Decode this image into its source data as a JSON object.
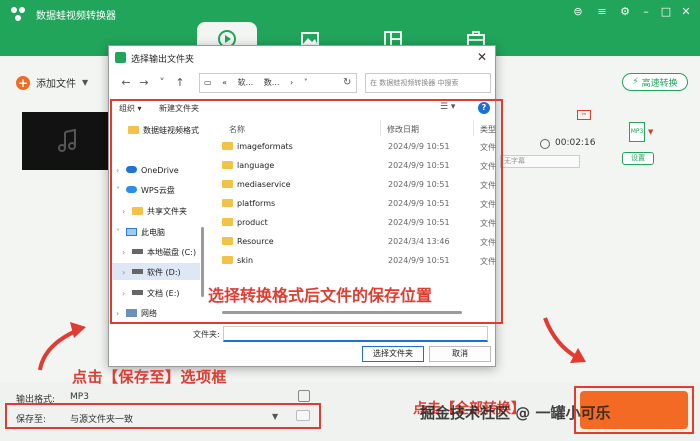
{
  "app": {
    "title": "数据蛙视频转换器",
    "nav_tabs": [
      "convert",
      "edit",
      "collage",
      "toolbox"
    ],
    "add_file_label": "添加文件",
    "high_speed_label": "高速转换",
    "duration": "00:02:16",
    "subtitle_placeholder": "无字幕",
    "format_badge": "MP3",
    "settings_label": "设置"
  },
  "bottom": {
    "output_format_label": "输出格式:",
    "output_format_value": "MP3",
    "save_to_label": "保存至:",
    "save_to_value": "与源文件夹一致"
  },
  "dialog": {
    "title": "选择输出文件夹",
    "breadcrumb": [
      "«",
      "软...",
      "数...",
      "›"
    ],
    "search_placeholder": "在 数据蛙视频转换器 中搜索",
    "organize_label": "组织 ▾",
    "new_folder_label": "新建文件夹",
    "tree": [
      {
        "label": "数据蛙视频格式",
        "icon": "folder"
      },
      {
        "label": "OneDrive",
        "icon": "cloud"
      },
      {
        "label": "WPS云盘",
        "icon": "wps-cloud"
      },
      {
        "label": "共享文件夹",
        "icon": "folder"
      },
      {
        "label": "此电脑",
        "icon": "pc"
      },
      {
        "label": "本地磁盘 (C:)",
        "icon": "drive"
      },
      {
        "label": "软件 (D:)",
        "icon": "drive"
      },
      {
        "label": "文档 (E:)",
        "icon": "drive"
      },
      {
        "label": "网络",
        "icon": "network"
      }
    ],
    "columns": {
      "name": "名称",
      "modified": "修改日期",
      "type": "类型"
    },
    "files": [
      {
        "name": "imageformats",
        "date": "2024/9/9 10:51",
        "type": "文件"
      },
      {
        "name": "language",
        "date": "2024/9/9 10:51",
        "type": "文件"
      },
      {
        "name": "mediaservice",
        "date": "2024/9/9 10:51",
        "type": "文件"
      },
      {
        "name": "platforms",
        "date": "2024/9/9 10:51",
        "type": "文件"
      },
      {
        "name": "product",
        "date": "2024/9/9 10:51",
        "type": "文件"
      },
      {
        "name": "Resource",
        "date": "2024/3/4 13:46",
        "type": "文件"
      },
      {
        "name": "skin",
        "date": "2024/9/9 10:51",
        "type": "文件"
      }
    ],
    "filename_label": "文件夹:",
    "select_button": "选择文件夹",
    "cancel_button": "取消"
  },
  "annotations": {
    "dialog_caption": "选择转换格式后文件的保存位置",
    "saveto_caption": "点击【保存至】选项框",
    "convert_caption": "点击【全部转换】"
  },
  "watermark": "掘金技术社区 @ 一罐小可乐",
  "colors": {
    "brand_green": "#20a55a",
    "accent_orange": "#f26a24",
    "annotation_red": "#e03c31",
    "link_blue": "#1d6fd6"
  }
}
